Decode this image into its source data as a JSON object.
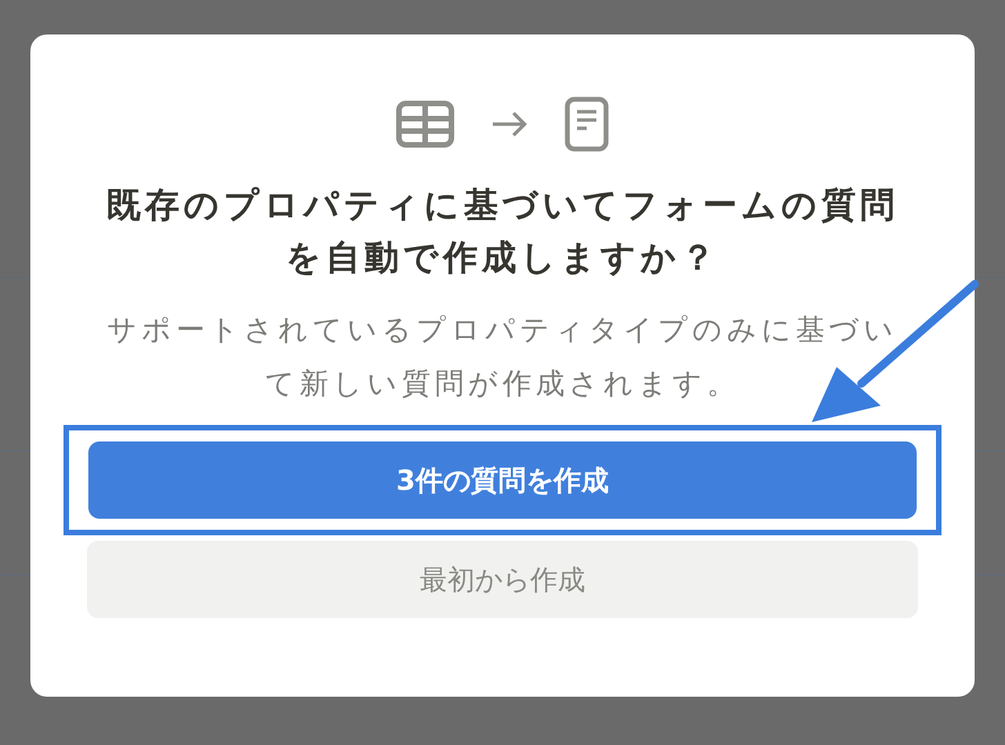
{
  "dialog": {
    "title": "既存のプロパティに基づいてフォームの質問を自動で作成しますか？",
    "description": "サポートされているプロパティタイプのみに基づいて新しい質問が作成されます。",
    "buttons": [
      {
        "label": "3件の質問を作成",
        "kind": "primary",
        "highlighted": true
      },
      {
        "label": "最初から作成",
        "kind": "secondary",
        "highlighted": false
      }
    ]
  }
}
